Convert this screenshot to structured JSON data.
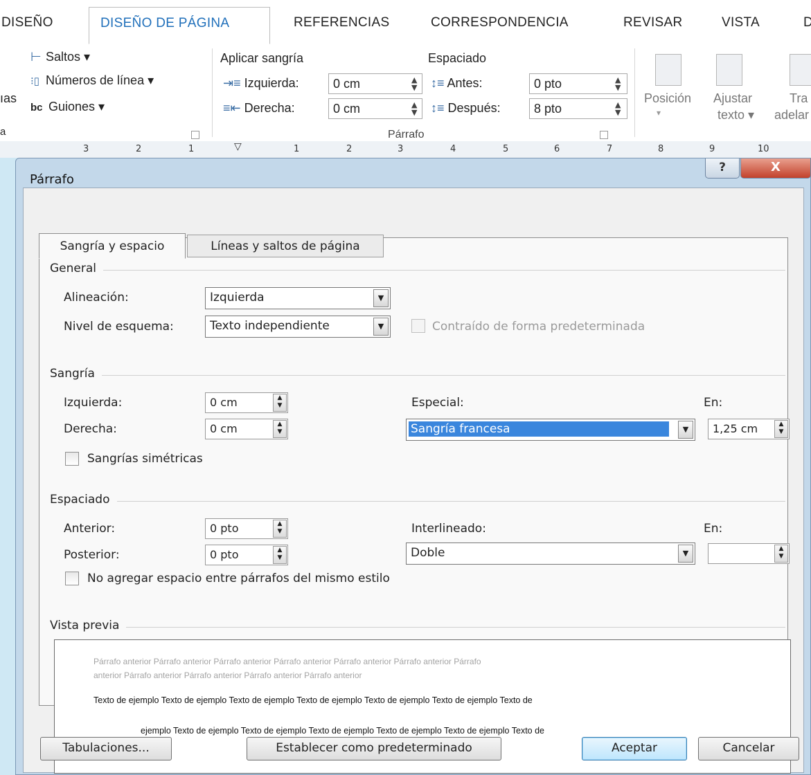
{
  "ribbon": {
    "tabs": [
      "DISEÑO",
      "DISEÑO DE PÁGINA",
      "REFERENCIAS",
      "CORRESPONDENCIA",
      "REVISAR",
      "VISTA",
      "D"
    ],
    "active_tab": "DISEÑO DE PÁGINA",
    "left_fragment": "ıas",
    "left_fragment2": "a",
    "saltos": "Saltos",
    "numeros_linea": "Números de línea",
    "guiones": "Guiones",
    "aplicar_sangria": "Aplicar sangría",
    "izquierda_label": "Izquierda:",
    "izquierda_value": "0 cm",
    "derecha_label": "Derecha:",
    "derecha_value": "0 cm",
    "espaciado": "Espaciado",
    "antes_label": "Antes:",
    "antes_value": "0 pto",
    "despues_label": "Después:",
    "despues_value": "8 pto",
    "parrafo_group": "Párrafo",
    "posicion": "Posición",
    "ajustar": "Ajustar",
    "texto": "texto",
    "traer_fragment": "Tra",
    "adelante_fragment": "adelar"
  },
  "ruler": {
    "ticks": [
      "3",
      "2",
      "1",
      "1",
      "2",
      "3",
      "4",
      "5",
      "6",
      "7",
      "8",
      "9",
      "10"
    ]
  },
  "dialog": {
    "title": "Párrafo",
    "help_glyph": "?",
    "close_glyph": "X",
    "tabs": {
      "indent_spacing": "Sangría y espacio",
      "lines_breaks": "Líneas y saltos de página"
    },
    "general": {
      "section": "General",
      "alignment_label": "Alineación:",
      "alignment_value": "Izquierda",
      "outline_label": "Nivel de esquema:",
      "outline_value": "Texto independiente",
      "collapsed_label": "Contraído de forma predeterminada"
    },
    "indent": {
      "section": "Sangría",
      "left_label": "Izquierda:",
      "left_value": "0 cm",
      "right_label": "Derecha:",
      "right_value": "0 cm",
      "special_label": "Especial:",
      "special_value": "Sangría francesa",
      "by_label": "En:",
      "by_value": "1,25 cm",
      "mirror_label": "Sangrías simétricas"
    },
    "spacing": {
      "section": "Espaciado",
      "before_label": "Anterior:",
      "before_value": "0 pto",
      "after_label": "Posterior:",
      "after_value": "0 pto",
      "line_label": "Interlineado:",
      "line_value": "Doble",
      "at_label": "En:",
      "at_value": "",
      "no_space_label": "No agregar espacio entre párrafos del mismo estilo"
    },
    "preview": {
      "section": "Vista previa",
      "prev_line1": "Párrafo anterior Párrafo anterior Párrafo anterior Párrafo anterior Párrafo anterior Párrafo anterior Párrafo",
      "prev_line2": "anterior Párrafo anterior Párrafo anterior Párrafo anterior Párrafo anterior",
      "sample_line1": "Texto de ejemplo Texto de ejemplo Texto de ejemplo Texto de ejemplo Texto de ejemplo Texto de ejemplo Texto de",
      "sample_line2": "ejemplo Texto de ejemplo Texto de ejemplo Texto de ejemplo Texto de ejemplo Texto de ejemplo Texto de"
    },
    "buttons": {
      "tabs": "Tabulaciones...",
      "set_default": "Establecer como predeterminado",
      "ok": "Aceptar",
      "cancel": "Cancelar"
    }
  },
  "colors": {
    "background": "#cfe8f4",
    "active_tab_text": "#1f6fba",
    "selection": "#3a86dd",
    "close_button": "#c2412b"
  }
}
